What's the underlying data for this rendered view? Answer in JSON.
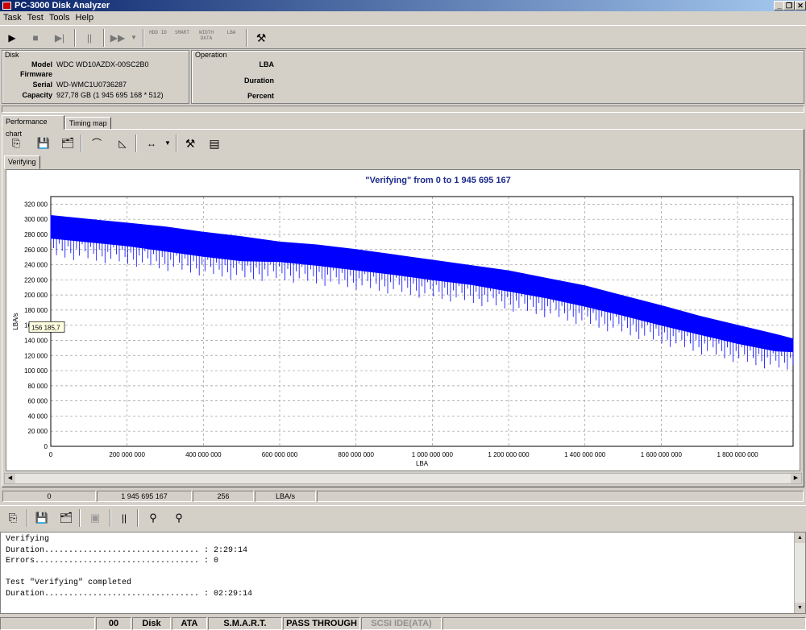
{
  "window": {
    "title": "PC-3000 Disk Analyzer"
  },
  "menu": [
    "Task",
    "Test",
    "Tools",
    "Help"
  ],
  "toolbar": {
    "hdd_id": "HDD ID",
    "smart": "SMART",
    "width_data": "WIDTH DATA",
    "lba": "LBA"
  },
  "disk": {
    "group_label": "Disk",
    "model_label": "Model",
    "model": "WDC WD10AZDX-00SC2B0",
    "firmware_label": "Firmware",
    "firmware": "",
    "serial_label": "Serial",
    "serial": "WD-WMC1U0736287",
    "capacity_label": "Capacity",
    "capacity": "927,78 GB (1 945 695 168 * 512)"
  },
  "operation": {
    "group_label": "Operation",
    "lba_label": "LBA",
    "duration_label": "Duration",
    "percent_label": "Percent"
  },
  "tabs": [
    "Performance chart",
    "Timing map"
  ],
  "subtab": "Verifying",
  "chart_data": {
    "type": "line",
    "title": "\"Verifying\" from 0 to 1 945 695 167",
    "xlabel": "LBA",
    "ylabel": "LBA/s",
    "xlim": [
      0,
      1945695167
    ],
    "ylim": [
      0,
      330000
    ],
    "x_ticks": [
      "0",
      "200 000 000",
      "400 000 000",
      "600 000 000",
      "800 000 000",
      "1 000 000 000",
      "1 200 000 000",
      "1 400 000 000",
      "1 600 000 000",
      "1 800 000 000"
    ],
    "y_ticks": [
      "0",
      "20 000",
      "40 000",
      "60 000",
      "80 000",
      "100 000",
      "120 000",
      "140 000",
      "160 000",
      "180 000",
      "200 000",
      "220 000",
      "240 000",
      "260 000",
      "280 000",
      "300 000",
      "320 000"
    ],
    "grid": true,
    "series": [
      {
        "color": "#0000ff",
        "x": [
          0,
          100000000,
          200000000,
          300000000,
          400000000,
          500000000,
          600000000,
          700000000,
          800000000,
          900000000,
          1000000000,
          1100000000,
          1200000000,
          1300000000,
          1400000000,
          1500000000,
          1600000000,
          1700000000,
          1800000000,
          1900000000,
          1945695167
        ],
        "upper": [
          305000,
          300000,
          295000,
          290000,
          283000,
          277000,
          270000,
          266000,
          260000,
          253000,
          246000,
          239000,
          232000,
          222000,
          212000,
          199000,
          186000,
          172000,
          160000,
          148000,
          142000
        ],
        "lower": [
          275000,
          270000,
          265000,
          258000,
          251000,
          245000,
          244000,
          239000,
          233000,
          227000,
          220000,
          214000,
          205000,
          196000,
          185000,
          173000,
          160000,
          148000,
          136000,
          126000,
          125000
        ]
      }
    ],
    "tooltip": "156 185,7"
  },
  "status_row": [
    "0",
    "1 945 695 167",
    "256",
    "LBA/s"
  ],
  "log": [
    "Verifying",
    "Duration................................ : 2:29:14",
    "Errors.................................. : 0",
    "",
    "Test \"Verifying\" completed",
    "Duration................................ : 02:29:14"
  ],
  "statusbar": [
    "00",
    "Disk",
    "ATA",
    "S.M.A.R.T.",
    "PASS THROUGH",
    "SCSI IDE(ATA)"
  ]
}
